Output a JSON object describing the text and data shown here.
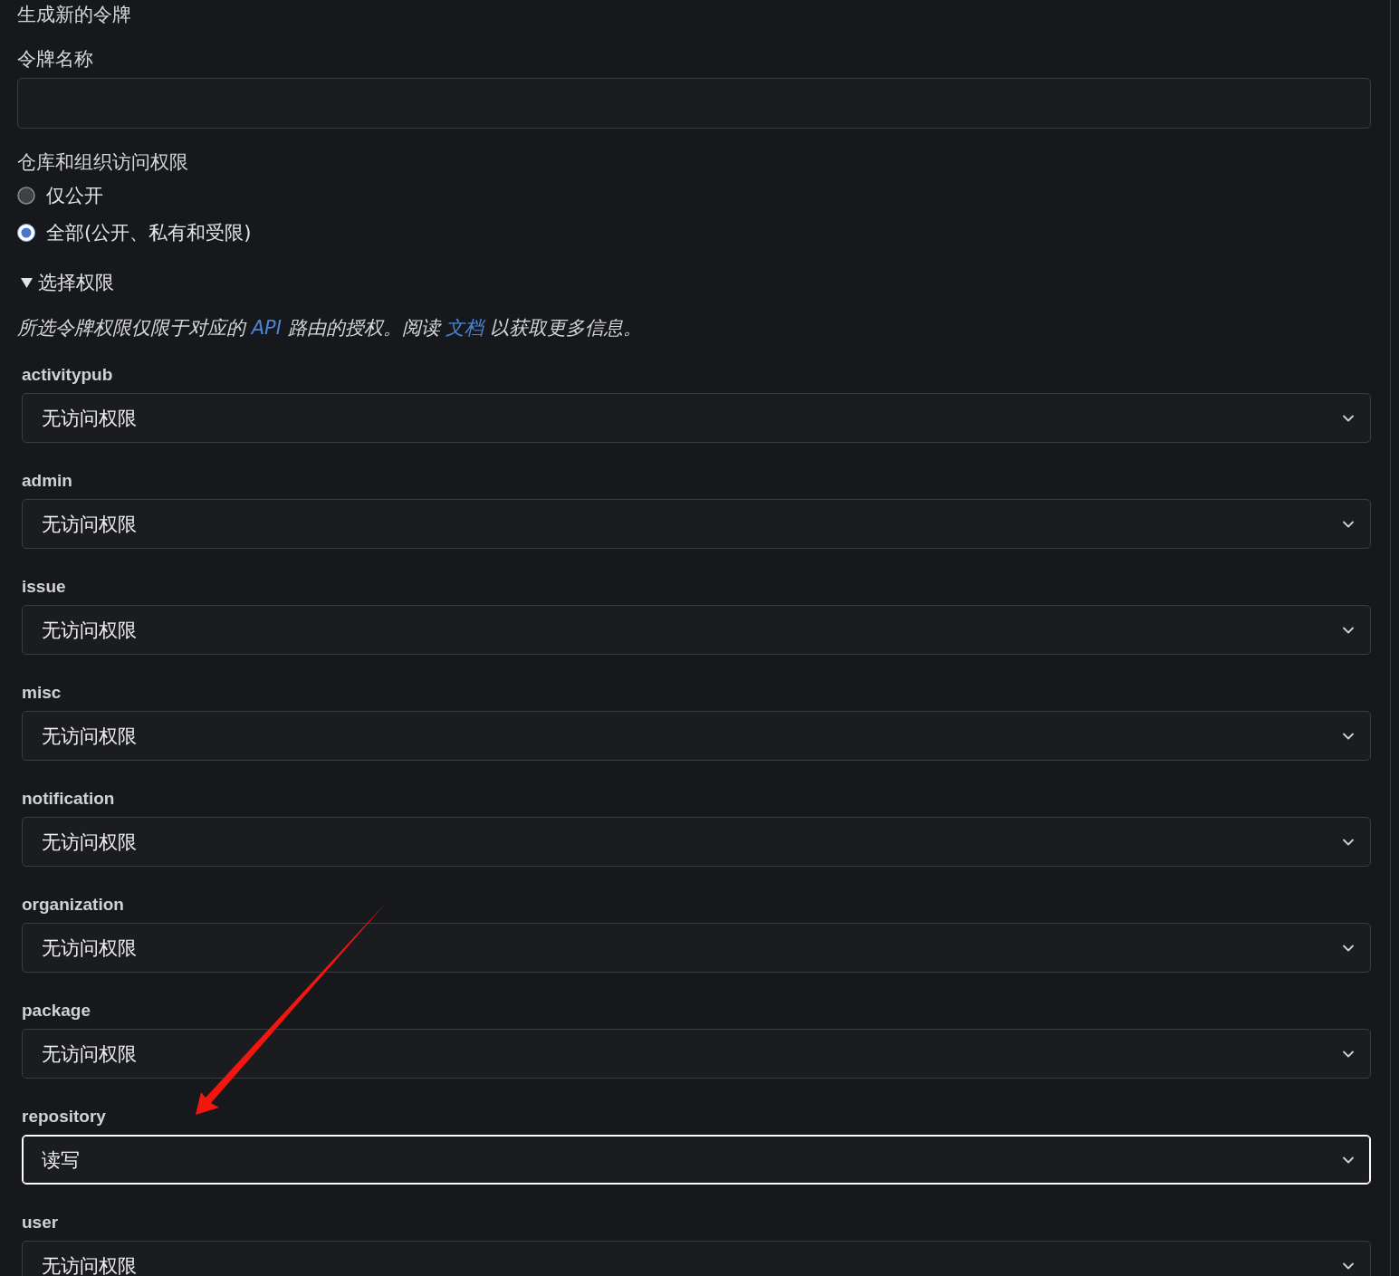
{
  "title": "生成新的令牌",
  "token_name": {
    "label": "令牌名称"
  },
  "access": {
    "label": "仓库和组织访问权限",
    "options": [
      {
        "label": "仅公开",
        "selected": false
      },
      {
        "label": "全部(公开、私有和受限)",
        "selected": true
      }
    ]
  },
  "permissions": {
    "summary": "选择权限",
    "expanded": true,
    "note": [
      {
        "kind": "text",
        "text": "所选令牌权限仅限于对应的 "
      },
      {
        "kind": "link",
        "text": "API"
      },
      {
        "kind": "text",
        "text": " 路由的授权。阅读 "
      },
      {
        "kind": "link",
        "text": "文档"
      },
      {
        "kind": "text",
        "text": " 以获取更多信息。"
      }
    ],
    "scopes": [
      {
        "name": "activitypub",
        "value": "无访问权限",
        "focused": false
      },
      {
        "name": "admin",
        "value": "无访问权限",
        "focused": false
      },
      {
        "name": "issue",
        "value": "无访问权限",
        "focused": false
      },
      {
        "name": "misc",
        "value": "无访问权限",
        "focused": false
      },
      {
        "name": "notification",
        "value": "无访问权限",
        "focused": false
      },
      {
        "name": "organization",
        "value": "无访问权限",
        "focused": false
      },
      {
        "name": "package",
        "value": "无访问权限",
        "focused": false
      },
      {
        "name": "repository",
        "value": "读写",
        "focused": true
      },
      {
        "name": "user",
        "value": "无访问权限",
        "focused": false
      }
    ]
  }
}
